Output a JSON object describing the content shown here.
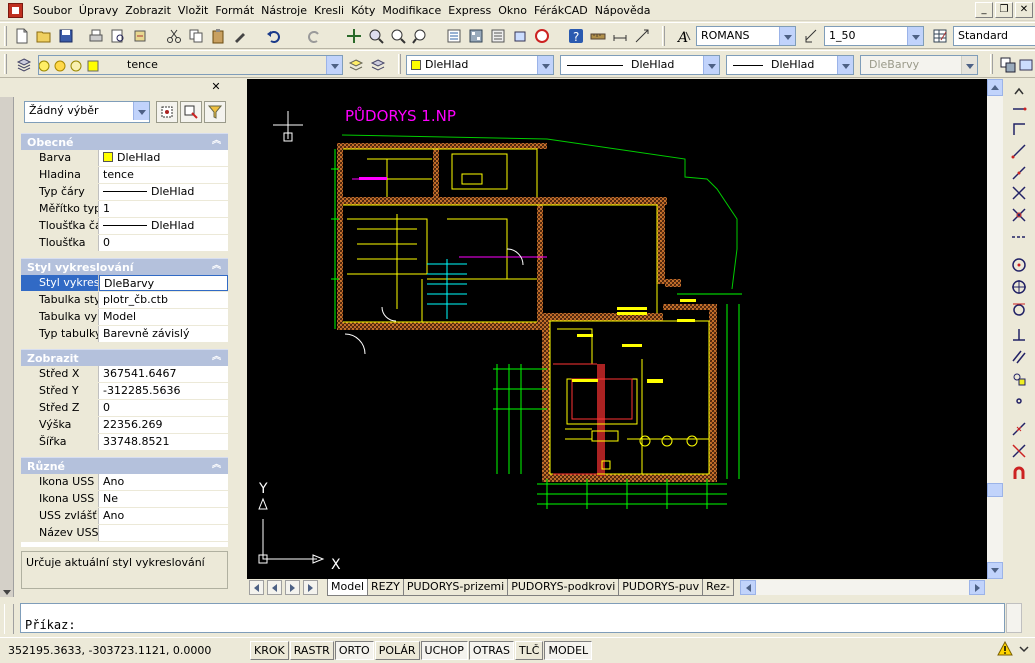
{
  "window": {
    "controls": [
      "_",
      "❐",
      "✕"
    ]
  },
  "menu": {
    "items": [
      "Soubor",
      "Úpravy",
      "Zobrazit",
      "Vložit",
      "Formát",
      "Nástroje",
      "Kresli",
      "Kóty",
      "Modifikace",
      "Express",
      "Okno",
      "FérákCAD",
      "Nápověda"
    ]
  },
  "toolbar1": {
    "text_style": "ROMANS",
    "dim_style": "1_50",
    "table_style": "Standard"
  },
  "toolbar2": {
    "layer": "tence",
    "color": "DleHlad",
    "linetype": "DleHlad",
    "lineweight": "DleHlad",
    "plot_style": "DleBarvy"
  },
  "colors": {
    "drawing_bg": "#000000",
    "panel_bg": "#ECE9D8",
    "category": "#B4C1DC",
    "selection": "#316AC5",
    "drawing_title": "#FF00FF",
    "walls": "#FFFF00",
    "dimensions": "#00FF00",
    "hatch": "#C86428"
  },
  "properties": {
    "selection": "Žádný výběr",
    "categories": [
      {
        "title": "Obecné",
        "rows": [
          {
            "name": "Barva",
            "value": "DleHlad",
            "kind": "color"
          },
          {
            "name": "Hladina",
            "value": "tence",
            "kind": "text"
          },
          {
            "name": "Typ čáry",
            "value": "DleHlad",
            "kind": "line"
          },
          {
            "name": "Měřítko typu...",
            "value": "1",
            "kind": "text"
          },
          {
            "name": "Tloušťka čáry",
            "value": "DleHlad",
            "kind": "line"
          },
          {
            "name": "Tloušťka",
            "value": "0",
            "kind": "text"
          }
        ]
      },
      {
        "title": "Styl vykreslování",
        "rows": [
          {
            "name": "Styl vykreslo...",
            "value": "DleBarvy",
            "kind": "text",
            "selected": true
          },
          {
            "name": "Tabulka styl...",
            "value": "plotr_čb.ctb",
            "kind": "text"
          },
          {
            "name": "Tabulka vykr...",
            "value": "Model",
            "kind": "text"
          },
          {
            "name": "Typ tabulky ...",
            "value": "Barevně závislý",
            "kind": "text"
          }
        ]
      },
      {
        "title": "Zobrazit",
        "rows": [
          {
            "name": "Střed X",
            "value": "367541.6467",
            "kind": "text"
          },
          {
            "name": "Střed Y",
            "value": "-312285.5636",
            "kind": "text"
          },
          {
            "name": "Střed Z",
            "value": "0",
            "kind": "text"
          },
          {
            "name": "Výška",
            "value": "22356.269",
            "kind": "text"
          },
          {
            "name": "Šířka",
            "value": "33748.8521",
            "kind": "text"
          }
        ]
      },
      {
        "title": "Různé",
        "rows": [
          {
            "name": "Ikona USS z...",
            "value": "Ano",
            "kind": "text"
          },
          {
            "name": "Ikona USS v ...",
            "value": "Ne",
            "kind": "text"
          },
          {
            "name": "USS zvlášť p...",
            "value": "Ano",
            "kind": "text"
          },
          {
            "name": "Název USS",
            "value": "",
            "kind": "text"
          }
        ]
      }
    ],
    "description": "Určuje aktuální styl vykreslování"
  },
  "drawing": {
    "title": "PŮDORYS 1.NP",
    "ucs_y": "Y",
    "ucs_x": "X"
  },
  "layout_tabs": [
    "Model",
    "REZY",
    "PUDORYS-prizemi",
    "PUDORYS-podkrovi",
    "PUDORYS-puv",
    "Rez-"
  ],
  "command": {
    "prompt": "Příkaz:"
  },
  "status": {
    "coords": "352195.3633, -303723.1121, 0.0000",
    "buttons": [
      {
        "label": "KROK",
        "on": false
      },
      {
        "label": "RASTR",
        "on": false
      },
      {
        "label": "ORTO",
        "on": true
      },
      {
        "label": "POLÁR",
        "on": false
      },
      {
        "label": "UCHOP",
        "on": true
      },
      {
        "label": "OTRAS",
        "on": true
      },
      {
        "label": "TLČ",
        "on": false
      },
      {
        "label": "MODEL",
        "on": true
      }
    ]
  }
}
